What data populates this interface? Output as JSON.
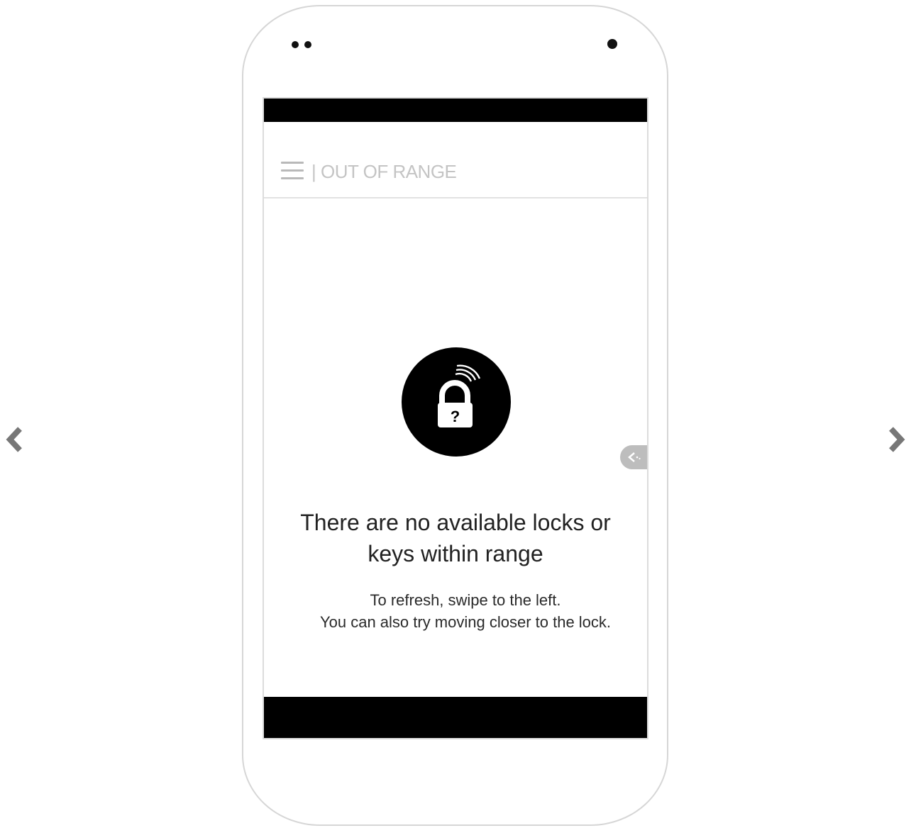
{
  "app_bar": {
    "title": "| OUT OF RANGE"
  },
  "main": {
    "headline": "There are no available locks or keys within range",
    "hint_line1": "To refresh, swipe to the left.",
    "hint_line2": "You can also try moving closer to the lock."
  },
  "icons": {
    "menu": "hamburger-menu-icon",
    "lock_status": "lock-question-signal-icon",
    "refresh_tab": "swipe-left-chevron-icon",
    "carousel_prev": "chevron-left-icon",
    "carousel_next": "chevron-right-icon"
  },
  "colors": {
    "bars": "#000000",
    "title_text": "#c4c4c4",
    "menu_icon": "#b9b9b9",
    "badge": "#000000",
    "refresh_tab": "#bdbdbd",
    "arrow": "#777777"
  }
}
